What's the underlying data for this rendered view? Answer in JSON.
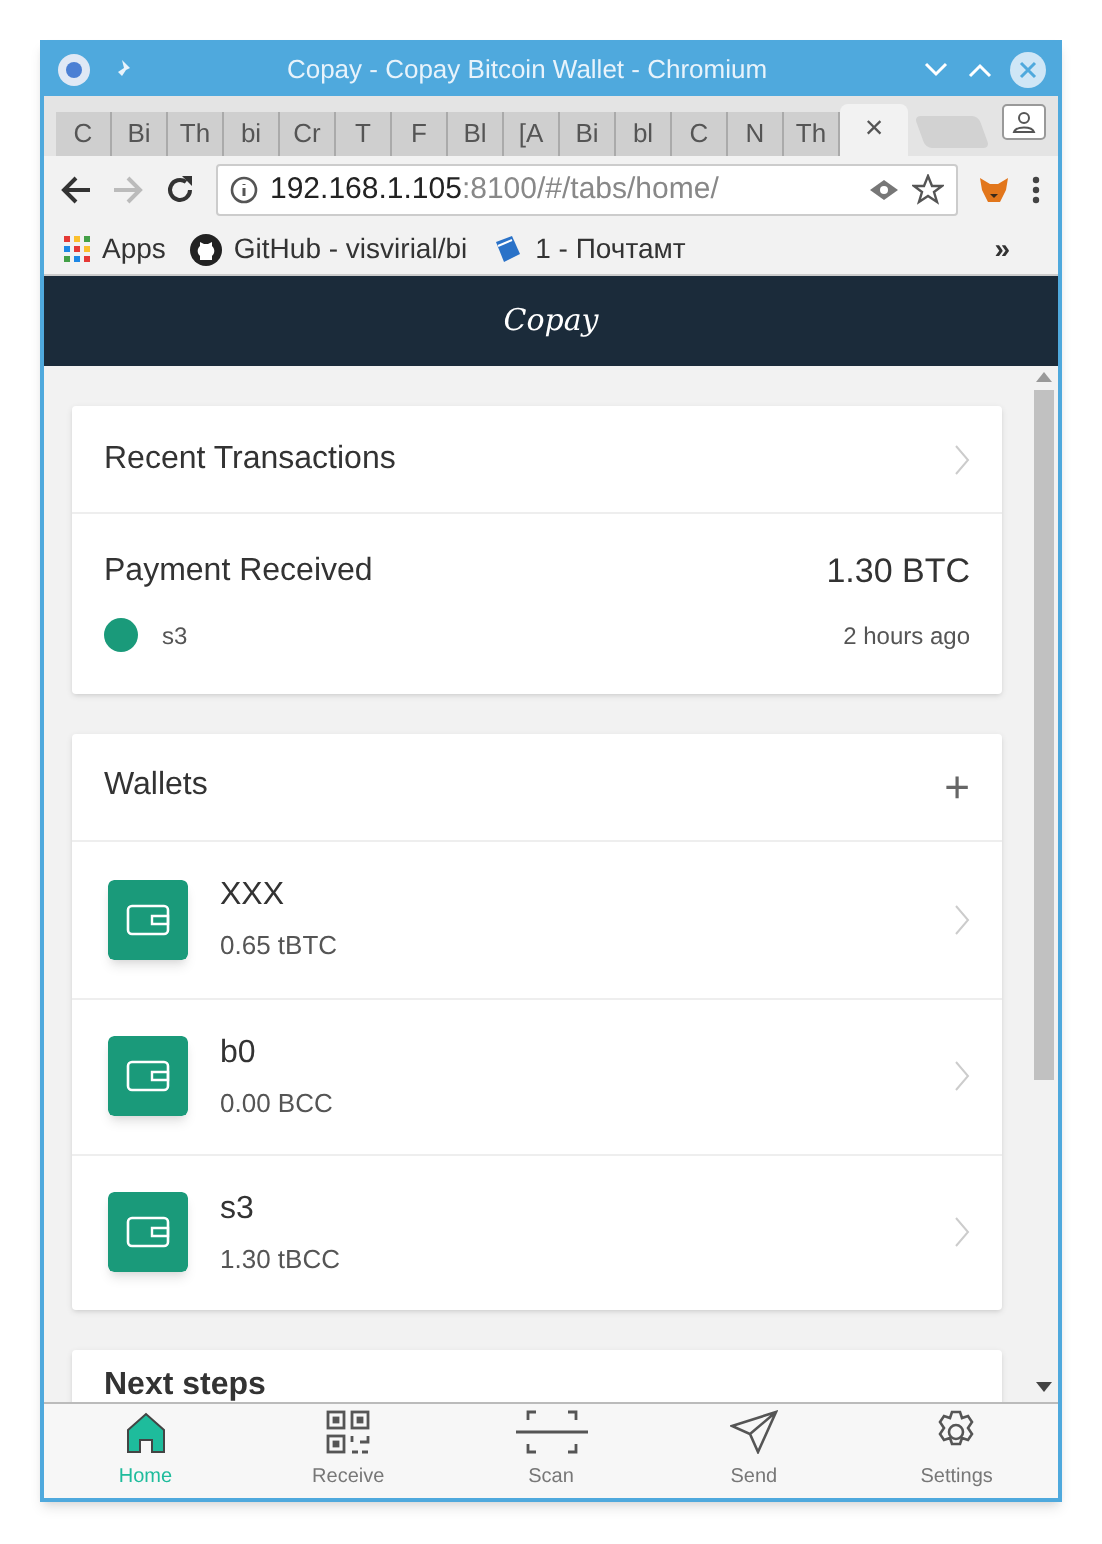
{
  "window": {
    "title": "Copay - Copay Bitcoin Wallet - Chromium"
  },
  "tabs": [
    {
      "label": "C",
      "selected": false
    },
    {
      "label": "Bi",
      "selected": false
    },
    {
      "label": "Th",
      "selected": false
    },
    {
      "label": "bi",
      "selected": false
    },
    {
      "label": "Cr",
      "selected": false
    },
    {
      "label": "T",
      "selected": false
    },
    {
      "label": "F",
      "selected": false
    },
    {
      "label": "Bl",
      "selected": false
    },
    {
      "label": "[A",
      "selected": false
    },
    {
      "label": "Bi",
      "selected": false
    },
    {
      "label": "bl",
      "selected": false
    },
    {
      "label": "C",
      "selected": false
    },
    {
      "label": "N",
      "selected": false
    },
    {
      "label": "Th",
      "selected": false
    },
    {
      "label": "×",
      "selected": true
    }
  ],
  "address_bar": {
    "host": "192.168.1.105",
    "path": ":8100/#/tabs/home/"
  },
  "bookmarks": [
    {
      "kind": "apps",
      "label": "Apps"
    },
    {
      "kind": "github",
      "label": "GitHub - visvirial/bi"
    },
    {
      "kind": "book",
      "label": "1 - Почтамт"
    }
  ],
  "bookmarks_more": "»",
  "app": {
    "logo": "Copay",
    "recent": {
      "title": "Recent Transactions",
      "items": [
        {
          "label": "Payment Received",
          "amount": "1.30 BTC",
          "wallet": "s3",
          "time": "2 hours ago",
          "color": "#1a9a7a"
        }
      ]
    },
    "wallets": {
      "title": "Wallets",
      "add": "+",
      "items": [
        {
          "name": "XXX",
          "balance": "0.65 tBTC"
        },
        {
          "name": "b0",
          "balance": "0.00 BCC"
        },
        {
          "name": "s3",
          "balance": "1.30 tBCC"
        }
      ]
    },
    "next_steps": {
      "title": "Next steps"
    }
  },
  "nav": [
    {
      "kind": "home",
      "label": "Home",
      "selected": true
    },
    {
      "kind": "receive",
      "label": "Receive",
      "selected": false
    },
    {
      "kind": "scan",
      "label": "Scan",
      "selected": false
    },
    {
      "kind": "send",
      "label": "Send",
      "selected": false
    },
    {
      "kind": "settings",
      "label": "Settings",
      "selected": false
    }
  ]
}
